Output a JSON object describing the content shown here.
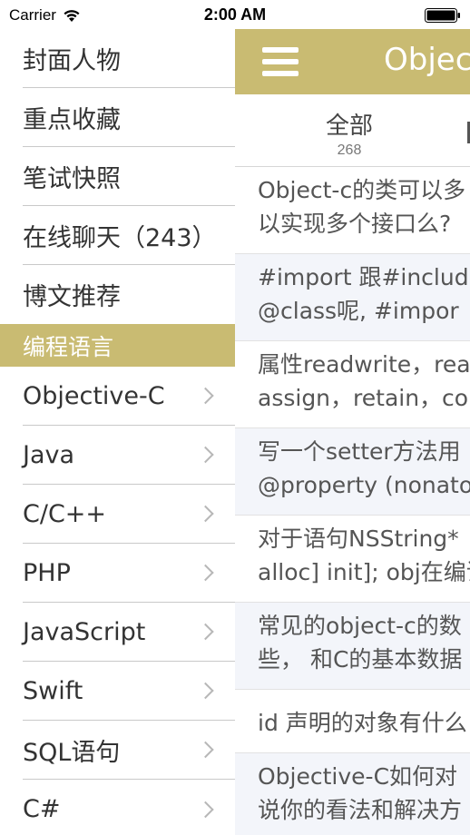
{
  "status_bar": {
    "carrier": "Carrier",
    "time": "2:00 AM"
  },
  "side_menu": {
    "items": [
      {
        "label": "封面人物"
      },
      {
        "label": "重点收藏"
      },
      {
        "label": "笔试快照"
      },
      {
        "label": "在线聊天（243）"
      },
      {
        "label": "博文推荐"
      }
    ],
    "section_title": "编程语言",
    "languages": [
      {
        "label": "Objective-C"
      },
      {
        "label": "Java"
      },
      {
        "label": "C/C++"
      },
      {
        "label": "PHP"
      },
      {
        "label": "JavaScript"
      },
      {
        "label": "Swift"
      },
      {
        "label": "SQL语句"
      },
      {
        "label": "C#"
      }
    ]
  },
  "main": {
    "nav_title": "Object",
    "tab": {
      "label": "全部",
      "count": "268"
    },
    "questions": [
      {
        "line1": "Object-c的类可以多",
        "line2": "以实现多个接口么?"
      },
      {
        "line1": "#import 跟#include",
        "line2": "@class呢, #impor"
      },
      {
        "line1": "属性readwrite，rea",
        "line2": "assign，retain，co"
      },
      {
        "line1": "写一个setter方法用",
        "line2": "@property (nonato"
      },
      {
        "line1": "对于语句NSString*",
        "line2": "alloc] init]; obj在编译"
      },
      {
        "line1": "常见的object-c的数",
        "line2": "些， 和C的基本数据"
      },
      {
        "line1": "id 声明的对象有什么",
        "line2": ""
      },
      {
        "line1": "Objective-C如何对",
        "line2": "说你的看法和解决方"
      }
    ]
  },
  "colors": {
    "accent": "#c9bb72",
    "separator": "#c9c9c9"
  }
}
